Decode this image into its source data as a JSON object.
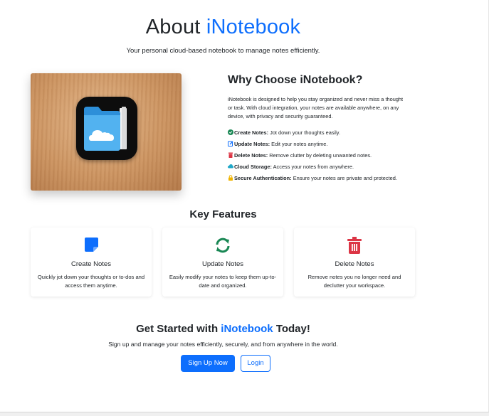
{
  "hero": {
    "title_prefix": "About",
    "title_brand": "iNotebook",
    "subtitle": "Your personal cloud-based notebook to manage notes efficiently."
  },
  "why": {
    "title_prefix": "Why Choose",
    "title_brand": "iNotebook?",
    "description": "iNotebook is designed to help you stay organized and never miss a thought or task. With cloud integration, your notes are available anywhere, on any device, with privacy and security guaranteed.",
    "features": [
      {
        "icon": "check-circle-icon",
        "title": "Create Notes:",
        "text": "Jot down your thoughts easily.",
        "color": "#198754"
      },
      {
        "icon": "edit-icon",
        "title": "Update Notes:",
        "text": "Edit your notes anytime.",
        "color": "#0d6efd"
      },
      {
        "icon": "trash-icon",
        "title": "Delete Notes:",
        "text": "Remove clutter by deleting unwanted notes.",
        "color": "#dc3545"
      },
      {
        "icon": "cloud-icon",
        "title": "Cloud Storage:",
        "text": "Access your notes from anywhere.",
        "color": "#20a8c8"
      },
      {
        "icon": "lock-icon",
        "title": "Secure Authentication:",
        "text": "Ensure your notes are private and protected.",
        "color": "#f0b400"
      }
    ]
  },
  "key_features": {
    "title": "Key Features",
    "cards": [
      {
        "icon": "sticky-note-icon",
        "title": "Create Notes",
        "text": "Quickly jot down your thoughts or to-dos and access them anytime.",
        "color": "#0d6efd"
      },
      {
        "icon": "sync-icon",
        "title": "Update Notes",
        "text": "Easily modify your notes to keep them up-to-date and organized.",
        "color": "#198754"
      },
      {
        "icon": "trash-icon",
        "title": "Delete Notes",
        "text": "Remove notes you no longer need and declutter your workspace.",
        "color": "#dc3545"
      }
    ]
  },
  "cta": {
    "title_prefix": "Get Started with",
    "title_brand": "iNotebook",
    "title_suffix": "Today!",
    "subtitle": "Sign up and manage your notes efficiently, securely, and from anywhere in the world.",
    "signup_label": "Sign Up Now",
    "login_label": "Login"
  },
  "colors": {
    "brand": "#0d6efd",
    "text": "#212529"
  }
}
